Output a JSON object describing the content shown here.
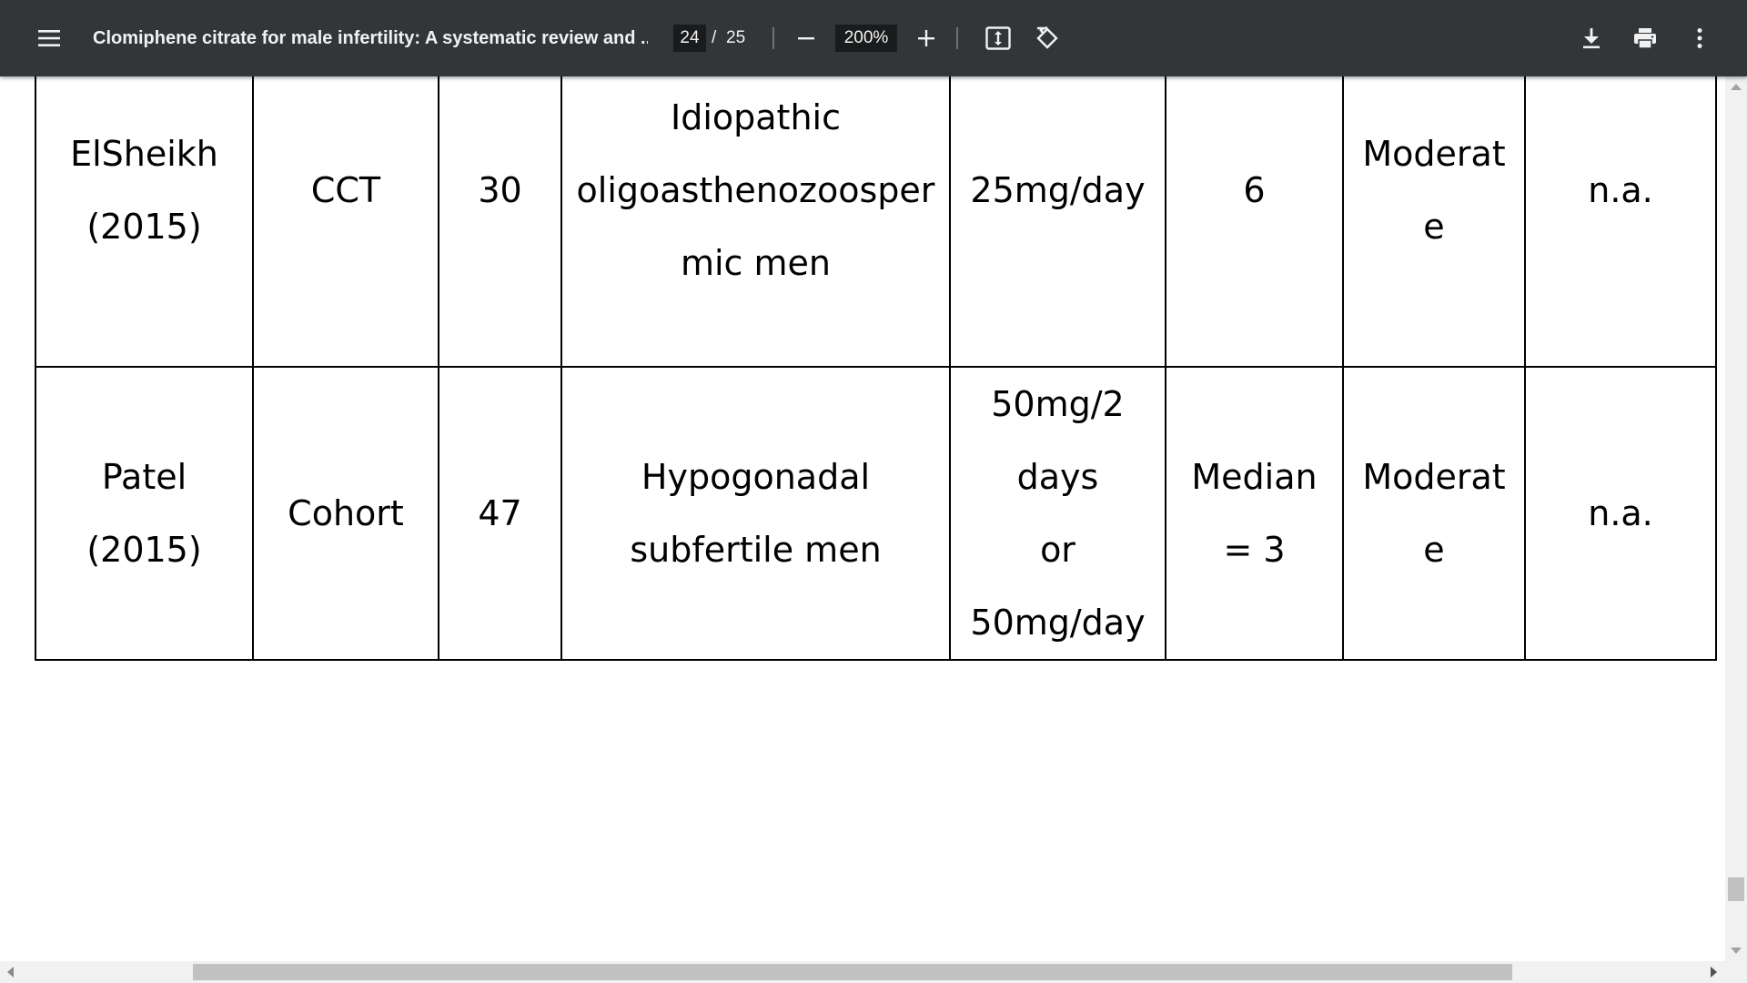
{
  "toolbar": {
    "title": "Clomiphene citrate for male infertility: A systematic review and ...",
    "current_page": "24",
    "page_separator": "/",
    "total_pages": "25",
    "zoom": "200%",
    "icons": {
      "menu": "menu-icon",
      "zoom_out": "minus-icon",
      "zoom_in": "plus-icon",
      "fit": "fit-to-page-icon",
      "rotate": "rotate-icon",
      "download": "download-icon",
      "print": "print-icon",
      "more": "more-vert-icon"
    }
  },
  "table": {
    "rows": [
      {
        "study": "ElSheikh\n(2015)",
        "design": "CCT",
        "n": "30",
        "population": "Idiopathic\noligoasthenozoosper\nmic men",
        "dose": "25mg/day",
        "duration": "6",
        "quality": "Moderat\ne",
        "other": "n.a."
      },
      {
        "study": "Patel\n(2015)",
        "design": "Cohort",
        "n": "47",
        "population": "Hypogonadal\nsubfertile men",
        "dose": "50mg/2\ndays\nor\n50mg/day",
        "duration": "Median\n= 3",
        "quality": "Moderat\ne",
        "other": "n.a."
      }
    ]
  },
  "colors": {
    "toolbar_bg": "#323639",
    "toolbar_text": "#f1f1f1",
    "input_bg": "#191b1c",
    "page_bg": "#ffffff"
  }
}
